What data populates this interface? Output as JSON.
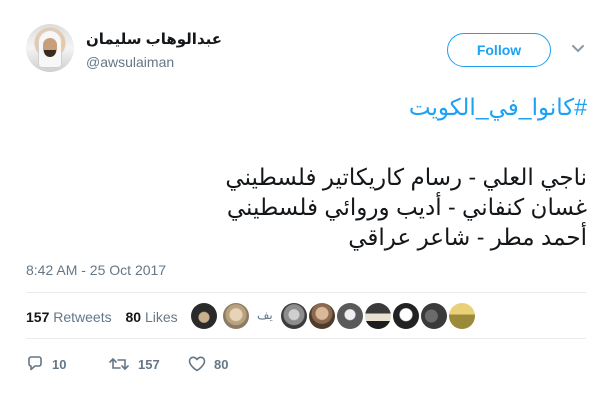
{
  "author": {
    "display_name": "عبدالوهاب سليمان",
    "handle": "@awsulaiman"
  },
  "follow_button": {
    "label": "Follow"
  },
  "tweet": {
    "hashtag": "#كانوا_في_الكويت",
    "lines": [
      "ناجي العلي - رسام كاريكاتير فلسطيني",
      "غسان كنفاني - أديب وروائي فلسطيني",
      "أحمد مطر - شاعر عراقي"
    ],
    "timestamp": "8:42 AM - 25 Oct 2017"
  },
  "stats": {
    "retweets_count": "157",
    "retweets_label": "Retweets",
    "likes_count": "80",
    "likes_label": "Likes"
  },
  "likers": {
    "avatar_icons": [
      "liker-avatar-1",
      "liker-avatar-2",
      "liker-avatar-3",
      "liker-avatar-4",
      "liker-avatar-5",
      "liker-avatar-6",
      "liker-avatar-7",
      "liker-avatar-8",
      "liker-avatar-9"
    ],
    "text_avatar": "يف"
  },
  "actions": {
    "reply_count": "10",
    "retweet_count": "157",
    "like_count": "80"
  },
  "colors": {
    "accent": "#1da1f2",
    "secondary_text": "#657786",
    "primary_text": "#14171a"
  }
}
